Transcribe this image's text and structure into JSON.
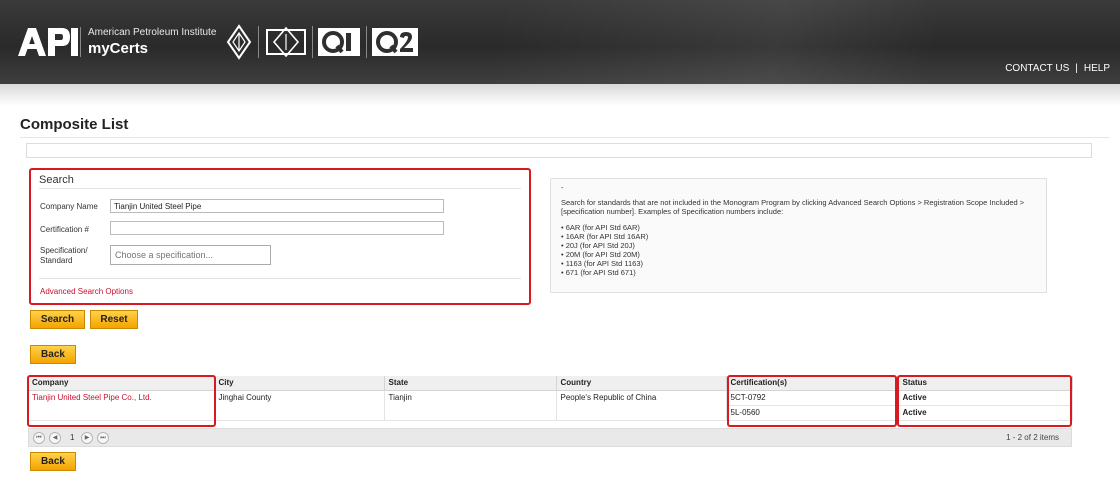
{
  "header": {
    "org_name": "American Petroleum Institute",
    "app_name": "myCerts",
    "nav": {
      "contact": "CONTACT US",
      "separator": "|",
      "help": "HELP"
    }
  },
  "page_title": "Composite List",
  "search": {
    "legend": "Search",
    "company_label": "Company Name",
    "company_value": "Tianjin United Steel Pipe",
    "cert_label": "Certification #",
    "cert_value": "",
    "spec_label_line1": "Specification/",
    "spec_label_line2": "Standard",
    "spec_placeholder": "Choose a specification...",
    "advanced_link": "Advanced Search Options"
  },
  "buttons": {
    "search": "Search",
    "reset": "Reset",
    "back": "Back"
  },
  "help": {
    "dash": "-",
    "intro": "Search for standards that are not included in the Monogram Program by clicking Advanced Search Options > Registration Scope Included > [specification number]. Examples of Specification numbers include:",
    "examples": [
      "6AR (for API Std 6AR)",
      "16AR (for API Std 16AR)",
      "20J (for API Std 20J)",
      "20M (for API Std 20M)",
      "1163 (for API Std 1163)",
      "671 (for API Std 671)"
    ]
  },
  "table": {
    "columns": [
      "Company",
      "City",
      "State",
      "Country",
      "Certification(s)",
      "Status"
    ],
    "rows": [
      {
        "company": "Tianjin United Steel Pipe Co., Ltd.",
        "city": "Jinghai County",
        "state": "Tianjin",
        "country": "People's Republic of China",
        "certifications": [
          {
            "number": "5CT-0792",
            "status": "Active"
          },
          {
            "number": "5L-0560",
            "status": "Active"
          }
        ]
      }
    ]
  },
  "pager": {
    "first_icon": "first-page-icon",
    "prev_icon": "prev-page-icon",
    "next_icon": "next-page-icon",
    "last_icon": "last-page-icon",
    "current_page": "1",
    "summary": "1 - 2 of 2 items"
  },
  "colors": {
    "accent_red": "#c8102e",
    "button_gold": "#f4a300",
    "header_dark": "#2f2f2f"
  }
}
